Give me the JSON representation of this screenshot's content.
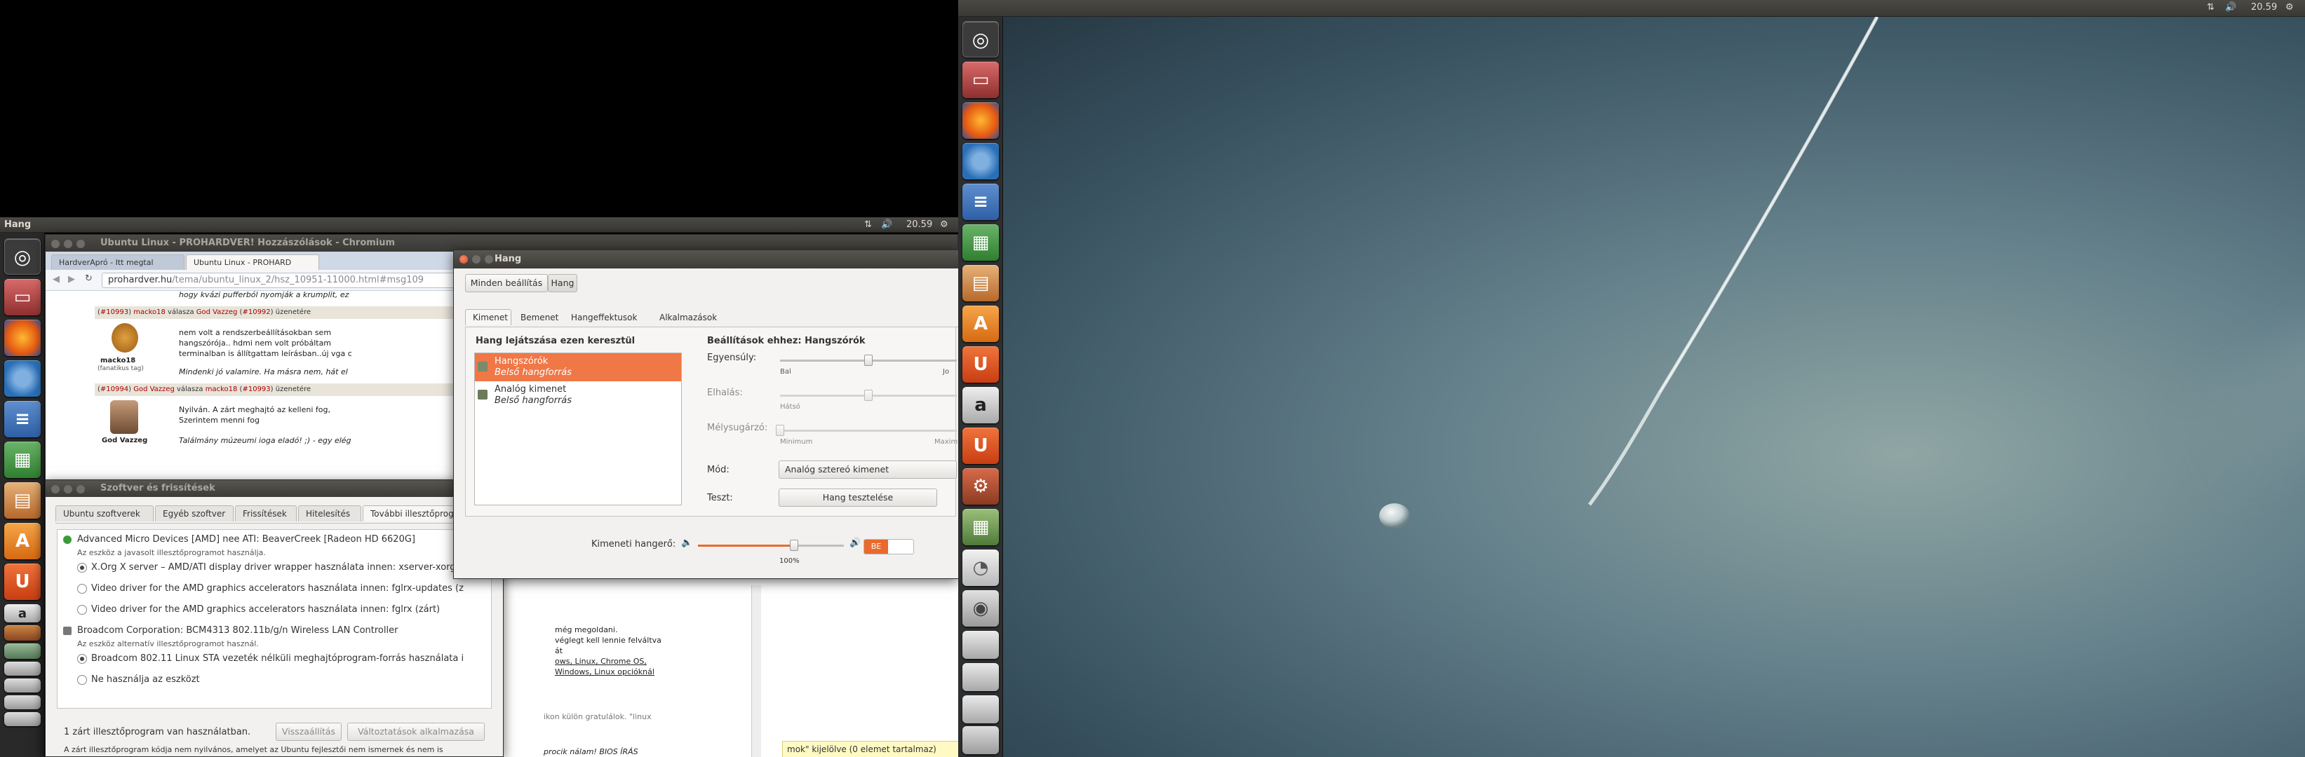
{
  "right_screen": {
    "panel": {
      "clock": "20.59"
    },
    "launcher": {
      "icons": [
        "ubuntu-dash-icon",
        "files-icon",
        "firefox-icon",
        "chromium-icon",
        "writer-icon",
        "calc-icon",
        "impress-icon",
        "software-center-icon",
        "ubuntu-one-icon",
        "amazon-icon",
        "ubuntu-one-music-icon",
        "system-settings-icon",
        "workspace-switcher-icon",
        "disk-icon",
        "camera-icon",
        "drive-icon",
        "drive-icon",
        "drive-icon",
        "trash-icon"
      ]
    }
  },
  "left_screen": {
    "panel": {
      "app_name": "Hang",
      "clock": "20.59"
    },
    "chromium": {
      "title": "Ubuntu Linux - PROHARDVER! Hozzászólások - Chromium",
      "tabs": [
        "HardverApró - Itt megtal",
        "Ubuntu Linux - PROHARD"
      ],
      "url_host": "prohardver.hu",
      "url_path": "/tema/ubuntu_linux_2/hsz_10951-11000.html#msg109",
      "top_line": "hogy kvázi pufferból nyomják a krumplit, ez",
      "post1_header": {
        "num": "#10993",
        "author": "macko18",
        "reply_word": "válasza",
        "to": "God Vazzeg",
        "to_num": "#10992",
        "suffix": "üzenetére"
      },
      "post1_user": "macko18",
      "post1_rank": "(fanatikus tag)",
      "post1_lines": [
        "nem volt a rendszerbeállításokban sem",
        "hangszórója.. hdmi nem volt próbáltam",
        "terminalban is állítgattam leírásban..új vga c"
      ],
      "post1_quote": "Mindenki jó valamire. Ha másra nem, hát el",
      "post2_header": {
        "num": "#10994",
        "author": "God Vazzeg",
        "reply_word": "válasza",
        "to": "macko18",
        "to_num": "#10993",
        "suffix": "üzenetére"
      },
      "post2_user": "God Vazzeg",
      "post2_lines": [
        "Nyilván. A zárt meghajtó az kelleni fog,",
        "Szerintem menni fog"
      ],
      "post2_quote": "Találmány múzeumi ioga eladó! ;) - egy elég",
      "post3_lines": [
        "még megoldani.",
        "véglegt kell lennie felváltva",
        "át",
        "ows, Linux, Chrome OS,",
        "Windows, Linux opcióknál"
      ],
      "post4_line": "ikon külön gratulálok. \"linux",
      "post5_line": "procik nálam! BIOS ÍRÁS",
      "findbar": "mok\" kijelölve  (0 elemet tartalmaz)"
    },
    "software": {
      "title": "Szoftver és frissítések",
      "tabs": [
        "Ubuntu szoftverek",
        "Egyéb szoftver",
        "Frissítések",
        "Hitelesítés",
        "További illesztőprogr"
      ],
      "device1": {
        "name": "Advanced Micro Devices [AMD] nee ATI: BeaverCreek [Radeon HD 6620G]",
        "desc": "Az eszköz a javasolt illesztőprogramot használja."
      },
      "device1_options": [
        "X.Org X server – AMD/ATI display driver wrapper használata innen: xserver-xorg-v",
        "Video driver for the AMD graphics accelerators használata innen: fglrx-updates (z",
        "Video driver for the AMD graphics accelerators használata innen: fglrx (zárt)"
      ],
      "device2": {
        "name": "Broadcom Corporation: BCM4313 802.11b/g/n Wireless LAN Controller",
        "desc": "Az eszköz alternatív illesztőprogramot használ."
      },
      "device2_options": [
        "Broadcom 802.11 Linux STA vezeték nélküli meghajtóprogram-forrás használata i",
        "Ne használja az eszközt"
      ],
      "status": "1 zárt illesztőprogram van használatban.",
      "revert": "Visszaállítás",
      "apply": "Változtatások alkalmazása",
      "footer": "A zárt illesztőprogram kódja nem nyilvános, amelyet az Ubuntu fejlesztői nem ismernek és nem is"
    },
    "sound": {
      "title": "Hang",
      "breadcrumb": [
        "Minden beállítás",
        "Hang"
      ],
      "tabs": [
        "Kimenet",
        "Bemenet",
        "Hangeffektusok",
        "Alkalmazások"
      ],
      "list_title": "Hang lejátszása ezen keresztül",
      "devices": [
        {
          "name": "Hangszórók",
          "sub": "Belső hangforrás"
        },
        {
          "name": "Analóg kimenet",
          "sub": "Belső hangforrás"
        }
      ],
      "settings_title": "Beállítások ehhez: Hangszórók",
      "balance_label": "Egyensúly:",
      "balance_left": "Bal",
      "balance_right": "Jo",
      "balance_value": 0.5,
      "fade_label": "Elhalás:",
      "fade_left": "Hátsó",
      "fade_value": 0.5,
      "subwoofer_label": "Mélysugárzó:",
      "subwoofer_min": "Minimum",
      "subwoofer_max": "Maxim",
      "subwoofer_value": 0.0,
      "mode_label": "Mód:",
      "mode_value": "Analóg sztereó kimenet",
      "test_label": "Teszt:",
      "test_button": "Hang tesztelése",
      "volume_label": "Kimeneti hangerő:",
      "volume_percent": "100%",
      "volume_value": 0.66,
      "mute_state": "BE"
    }
  }
}
